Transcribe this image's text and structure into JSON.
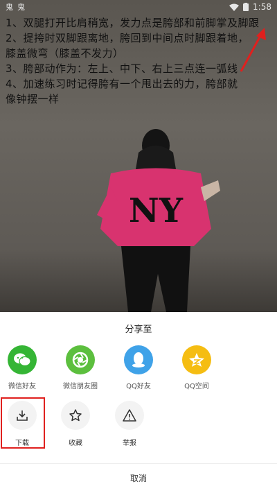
{
  "status_bar": {
    "left_icons": [
      "鬼",
      "鬼"
    ],
    "time": "1:58"
  },
  "overlay": {
    "lines": [
      "1、双腿打开比肩稍宽，发力点是胯部和前脚掌及脚跟",
      "2、提挎时双脚跟离地，胯回到中间点时脚跟着地，",
      "膝盖微弯（膝盖不发力）",
      "3、胯部动作为：左上、中下、右上三点连一弧线",
      "4、加速练习时记得胯有一个甩出去的力，胯部就",
      "像钟摆一样"
    ]
  },
  "share_sheet": {
    "title": "分享至",
    "share_targets": [
      {
        "label": "微信好友",
        "icon": "wechat-icon",
        "color": "#35b535"
      },
      {
        "label": "微信朋友圈",
        "icon": "moments-icon",
        "color": "#5cbf3e"
      },
      {
        "label": "QQ好友",
        "icon": "qq-icon",
        "color": "#3fa2e8"
      },
      {
        "label": "QQ空间",
        "icon": "qzone-icon",
        "color": "#f5bd12"
      }
    ],
    "actions": [
      {
        "label": "下载",
        "icon": "download-icon"
      },
      {
        "label": "收藏",
        "icon": "star-icon"
      },
      {
        "label": "举报",
        "icon": "warning-icon"
      }
    ],
    "cancel_label": "取消"
  },
  "colors": {
    "highlight": "#e0201e",
    "sheet_bg": "#ffffff"
  }
}
